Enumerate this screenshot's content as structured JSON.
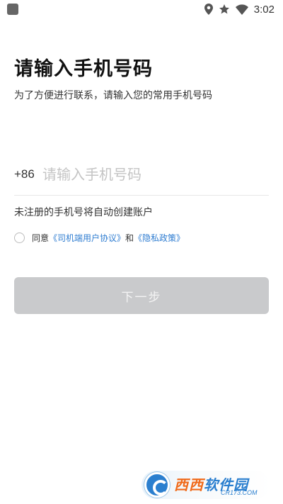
{
  "status_bar": {
    "time": "3:02",
    "icons": [
      "location-icon",
      "star-icon",
      "wifi-icon"
    ]
  },
  "header": {
    "title": "请输入手机号码",
    "subtitle": "为了方便进行联系，请输入您的常用手机号码"
  },
  "phone": {
    "country_code": "+86",
    "placeholder": "请输入手机号码",
    "value": ""
  },
  "register_hint": "未注册的手机号将自动创建账户",
  "agreement": {
    "checked": false,
    "prefix": "同意",
    "driver_agreement_link": "《司机端用户协议》",
    "conjunction": "和",
    "privacy_policy_link": "《隐私政策》"
  },
  "next_button": {
    "label": "下一步",
    "enabled": false
  },
  "watermark": {
    "brand_part1": "西西",
    "brand_part2": "软件园",
    "domain": "CR173.COM"
  },
  "colors": {
    "link": "#2f7dd1",
    "button_disabled": "#c9cacc",
    "placeholder": "#c4c4c4"
  }
}
